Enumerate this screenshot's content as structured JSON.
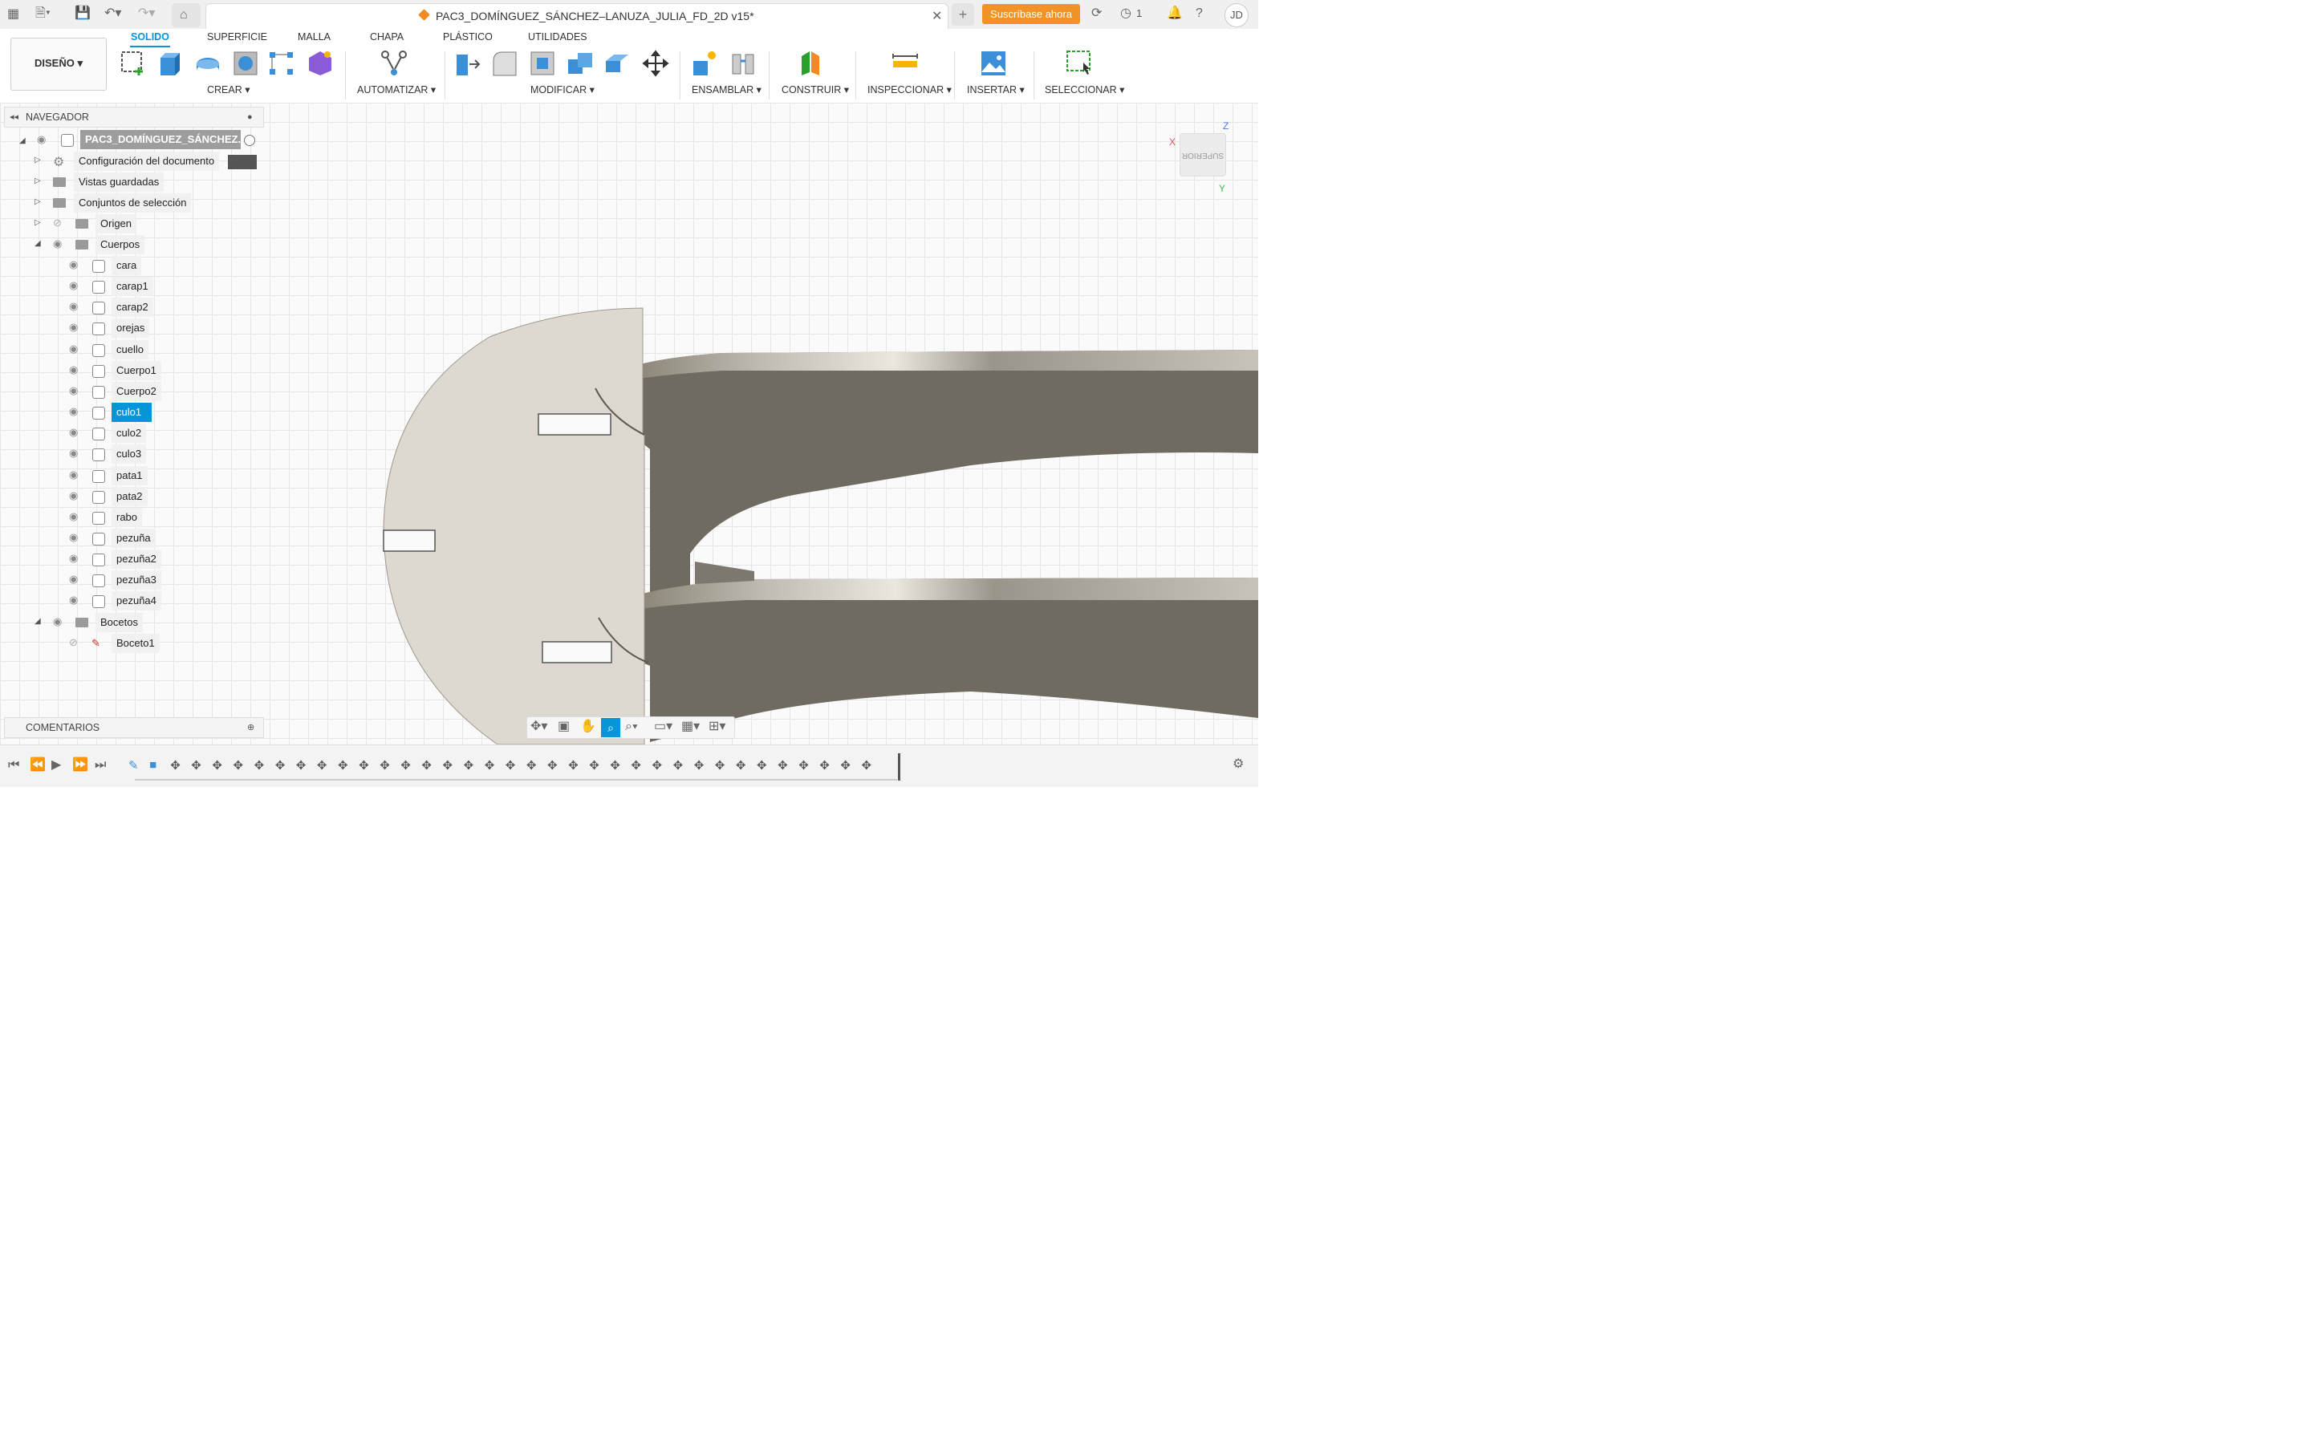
{
  "app": {
    "document_title": "PAC3_DOMÍNGUEZ_SÁNCHEZ–LANUZA_JULIA_FD_2D v15*",
    "subscribe_label": "Suscríbase ahora",
    "job_count": "1",
    "user_initials": "JD",
    "accent_color": "#0696d7",
    "subscribe_color": "#f29425"
  },
  "toolbar": {
    "workspace_label": "DISEÑO",
    "tabs": [
      "SOLIDO",
      "SUPERFICIE",
      "MALLA",
      "CHAPA",
      "PLÁSTICO",
      "UTILIDADES"
    ],
    "active_tab": "SOLIDO",
    "groups": [
      "CREAR",
      "AUTOMATIZAR",
      "MODIFICAR",
      "ENSAMBLAR",
      "CONSTRUIR",
      "INSPECCIONAR",
      "INSERTAR",
      "SELECCIONAR"
    ]
  },
  "navigator": {
    "header": "NAVEGADOR",
    "root": "PAC3_DOMÍNGUEZ_SÁNCHEZ...",
    "items": [
      {
        "label": "Configuración del documento"
      },
      {
        "label": "Vistas guardadas"
      },
      {
        "label": "Conjuntos de selección"
      },
      {
        "label": "Origen"
      },
      {
        "label": "Cuerpos"
      }
    ],
    "bodies": [
      "cara",
      "carap1",
      "carap2",
      "orejas",
      "cuello",
      "Cuerpo1",
      "Cuerpo2",
      "culo1",
      "culo2",
      "culo3",
      "pata1",
      "pata2",
      "rabo",
      "pezuña",
      "pezuña2",
      "pezuña3",
      "pezuña4"
    ],
    "selected_body": "culo1",
    "sketch_folder": "Bocetos",
    "sketches": [
      "Boceto1"
    ]
  },
  "comments": {
    "header": "COMENTARIOS"
  },
  "viewcube": {
    "face": "SUPERIOR",
    "x_label": "X",
    "y_label": "Y",
    "z_label": "Z"
  }
}
